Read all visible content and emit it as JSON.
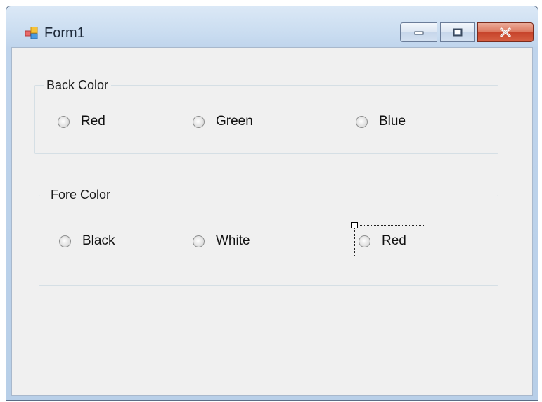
{
  "window": {
    "title": "Form1",
    "icon": "winforms-form-icon",
    "controls": {
      "minimize": "minimize-icon",
      "maximize": "maximize-icon",
      "close": "close-icon"
    },
    "close_color": "#c6432a"
  },
  "back_color_group": {
    "label": "Back Color",
    "options": [
      "Red",
      "Green",
      "Blue"
    ]
  },
  "fore_color_group": {
    "label": "Fore Color",
    "options": [
      "Black",
      "White",
      "Red"
    ],
    "focused_option": "Red"
  }
}
